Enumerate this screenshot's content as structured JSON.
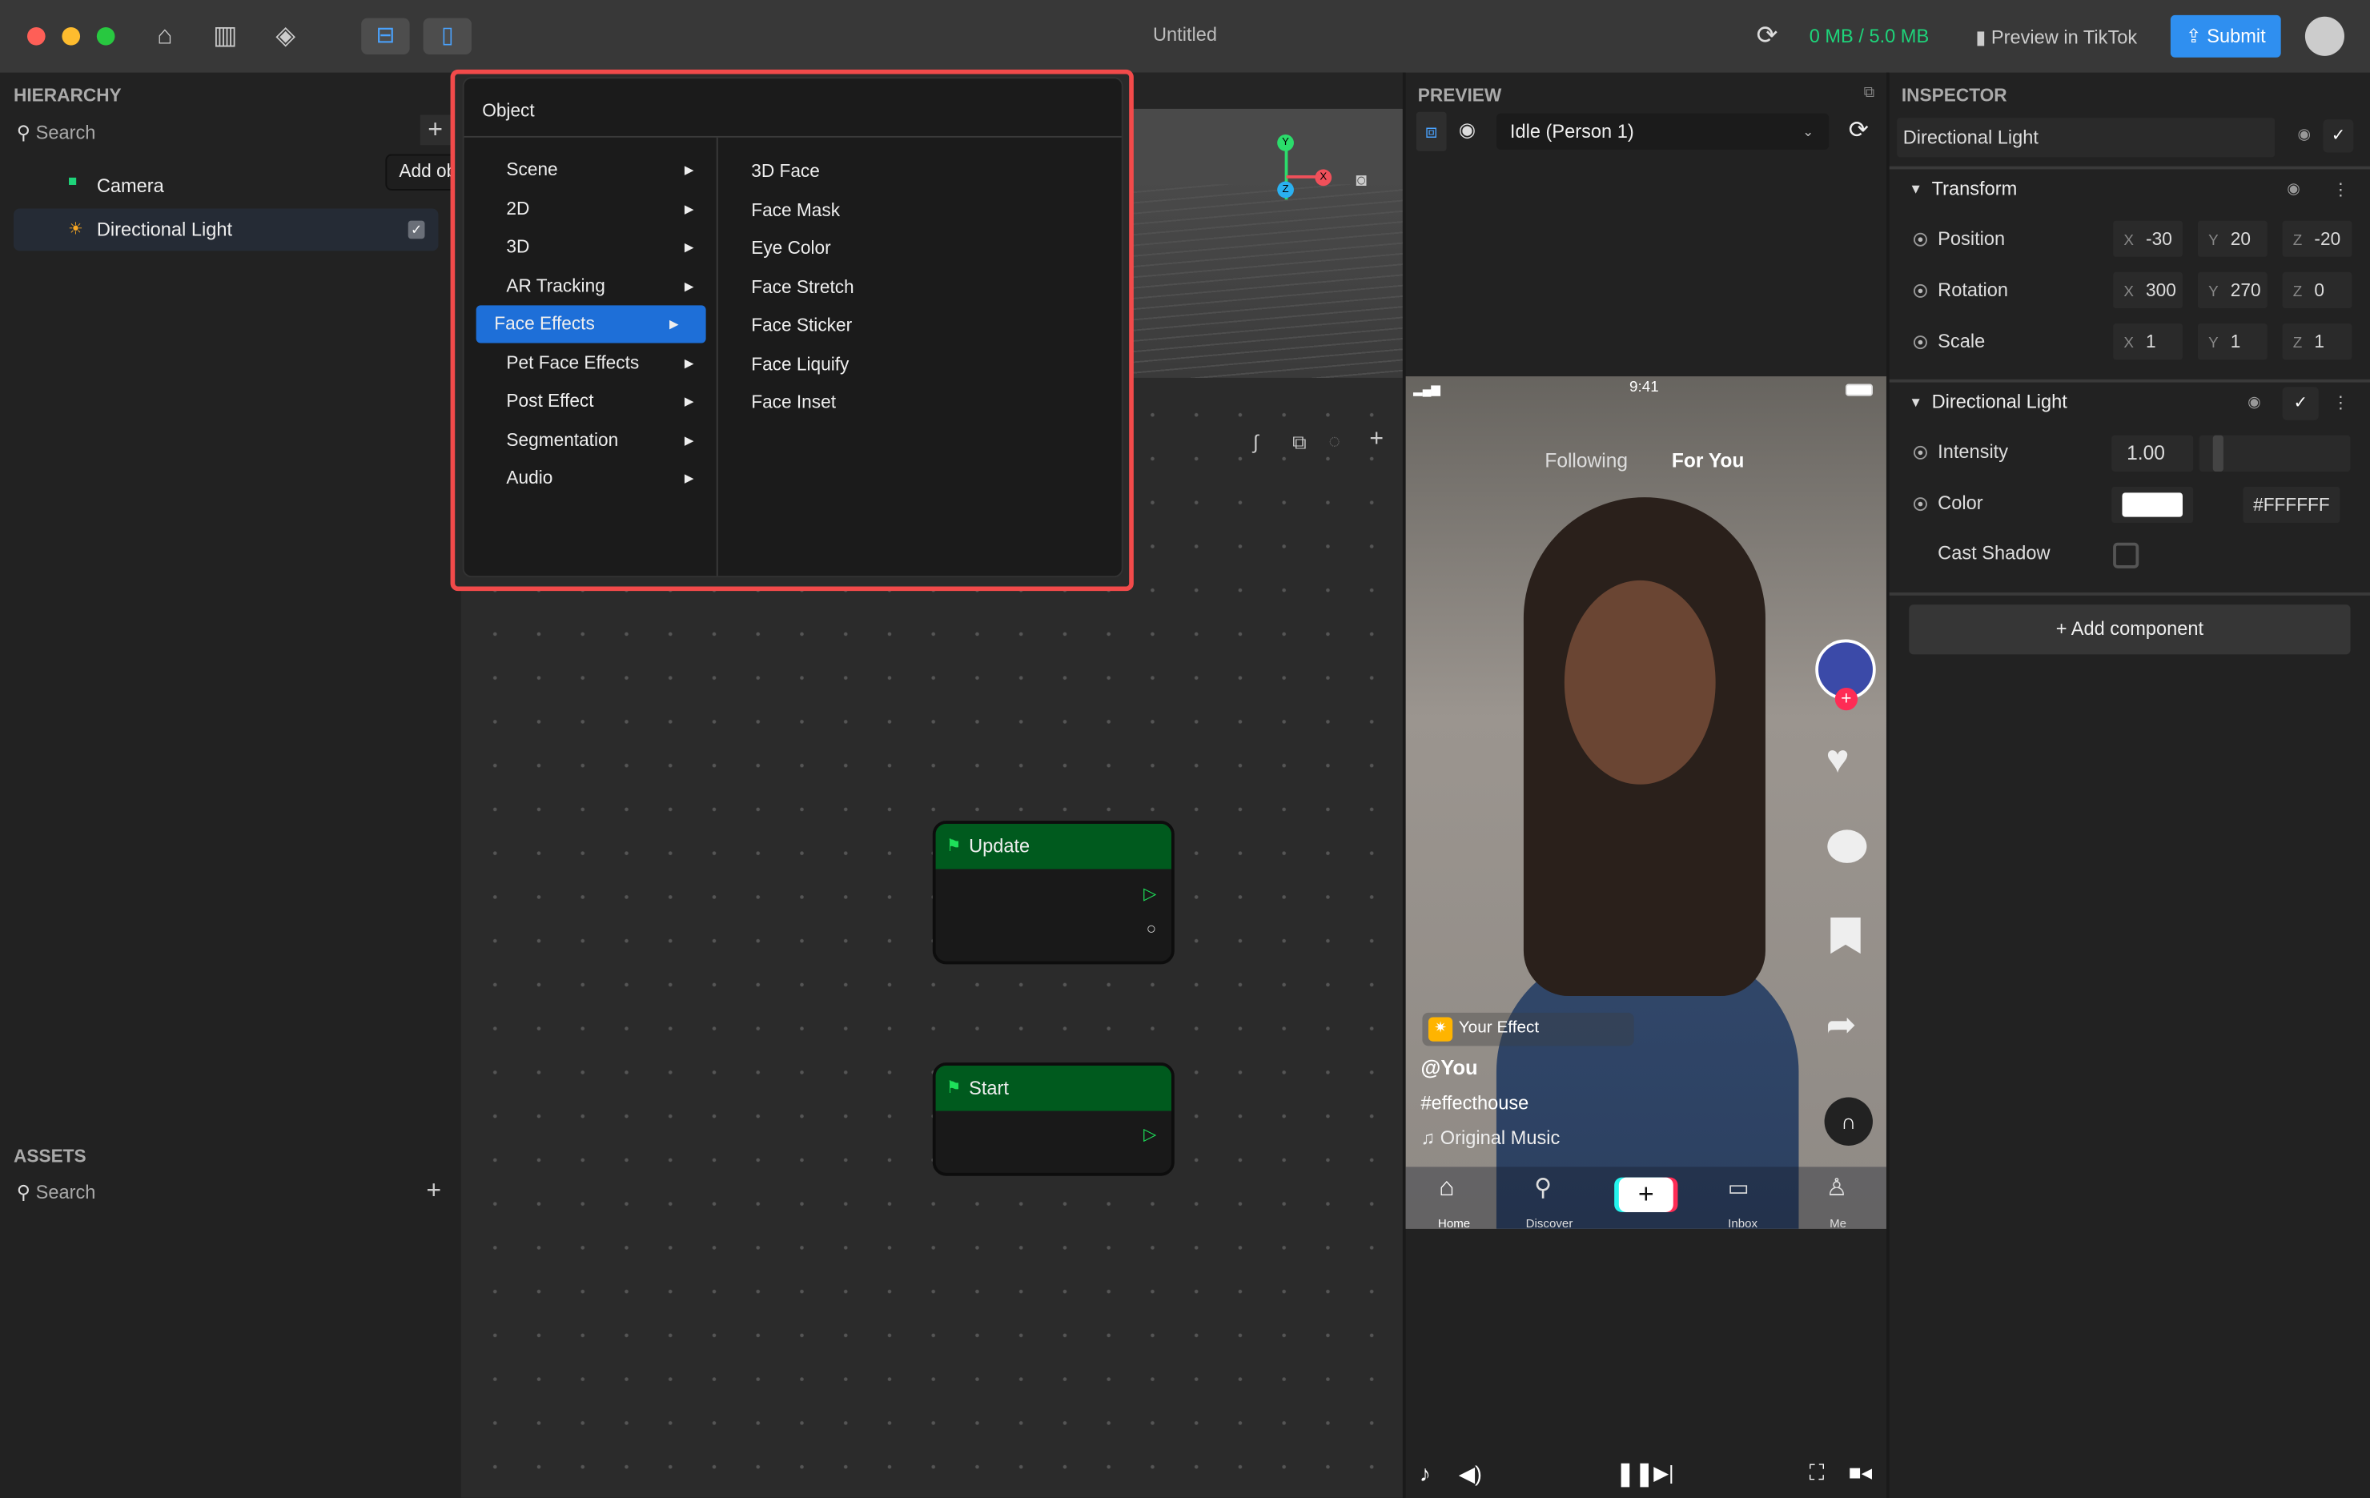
{
  "window": {
    "title": "Untitled"
  },
  "toolbar": {
    "storage": "0 MB / 5.0 MB",
    "preview_tiktok": "Preview in TikTok",
    "submit": "Submit",
    "accent": "#2f8ff0",
    "storage_color": "#1ed47a"
  },
  "hierarchy": {
    "title": "HIERARCHY",
    "search_placeholder": "Search",
    "tooltip": "Add object",
    "items": [
      {
        "label": "Camera",
        "icon": "camera-icon"
      },
      {
        "label": "Directional Light",
        "icon": "sun-icon",
        "checked": true
      }
    ]
  },
  "assets": {
    "title": "ASSETS",
    "search_placeholder": "Search"
  },
  "menu": {
    "header": "Object",
    "categories": [
      "Scene",
      "2D",
      "3D",
      "AR Tracking",
      "Face Effects",
      "Pet Face Effects",
      "Post Effect",
      "Segmentation",
      "Audio"
    ],
    "selected": "Face Effects",
    "submenu": [
      "3D Face",
      "Face Mask",
      "Eye Color",
      "Face Stretch",
      "Face Sticker",
      "Face Liquify",
      "Face Inset"
    ],
    "highlight_color": "#f24a4a"
  },
  "graph": {
    "nodes": [
      {
        "title": "Update"
      },
      {
        "title": "Start"
      }
    ]
  },
  "preview": {
    "title": "PREVIEW",
    "mode": "Idle (Person 1)",
    "phone": {
      "time": "9:41",
      "tab_following": "Following",
      "tab_foryou": "For You",
      "effect": "Your Effect",
      "user": "@You",
      "hashtag": "#effecthouse",
      "music": "Original Music",
      "nav": [
        "Home",
        "Discover",
        "Inbox",
        "Me"
      ]
    }
  },
  "inspector": {
    "title": "INSPECTOR",
    "object_name": "Directional Light",
    "transform": {
      "title": "Transform",
      "position": {
        "label": "Position",
        "x": "-30",
        "y": "20",
        "z": "-20"
      },
      "rotation": {
        "label": "Rotation",
        "x": "300",
        "y": "270",
        "z": "0"
      },
      "scale": {
        "label": "Scale",
        "x": "1",
        "y": "1",
        "z": "1"
      }
    },
    "light": {
      "title": "Directional Light",
      "intensity_label": "Intensity",
      "intensity": "1.00",
      "color_label": "Color",
      "color": "#FFFFFF",
      "cast_shadow_label": "Cast Shadow",
      "cast_shadow": false
    },
    "add_component": "+ Add component"
  }
}
